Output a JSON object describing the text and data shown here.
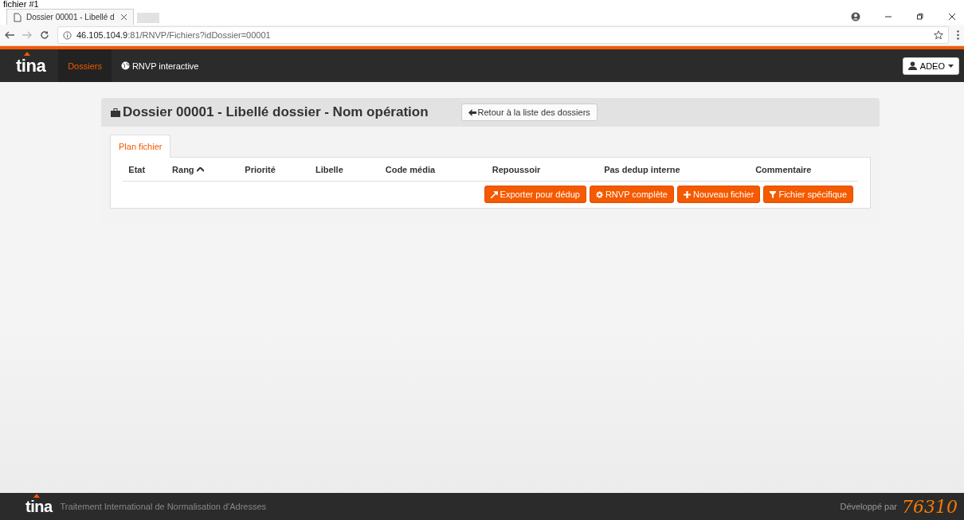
{
  "caption": "fichier #1",
  "browser": {
    "tab_title": "Dossier 00001 - Libellé d",
    "url_host": "46.105.104.9",
    "url_rest": ":81/RNVP/Fichiers?idDossier=00001"
  },
  "navbar": {
    "logo": "tina",
    "items": [
      {
        "label": "Dossiers",
        "selected": true,
        "kind": "plain"
      },
      {
        "label": "RNVP interactive",
        "selected": false,
        "kind": "globe"
      }
    ],
    "user": "ADEO"
  },
  "panel": {
    "title": "Dossier 00001 - Libellé dossier - Nom opération",
    "back_button": "Retour à la liste des dossiers",
    "tabs": [
      {
        "label": "Plan fichier",
        "selected": true
      }
    ],
    "columns": [
      {
        "label": "Etat",
        "sorted": false
      },
      {
        "label": "Rang",
        "sorted": true
      },
      {
        "label": "Priorité",
        "sorted": false
      },
      {
        "label": "Libelle",
        "sorted": false
      },
      {
        "label": "Code média",
        "sorted": false
      },
      {
        "label": "Repoussoir",
        "sorted": false
      },
      {
        "label": "Pas dedup interne",
        "sorted": false
      },
      {
        "label": "Commentaire",
        "sorted": false
      }
    ],
    "actions": [
      {
        "label": "Exporter pour dédup",
        "kind": "export"
      },
      {
        "label": "RNVP complète",
        "kind": "gear"
      },
      {
        "label": "Nouveau fichier",
        "kind": "plus"
      },
      {
        "label": "Fichier spécifique",
        "kind": "filter"
      }
    ]
  },
  "footer": {
    "logo": "tina",
    "tagline": "Traitement International de Normalisation d'Adresses",
    "credit": "Développé par",
    "credit_logo": "76310"
  }
}
